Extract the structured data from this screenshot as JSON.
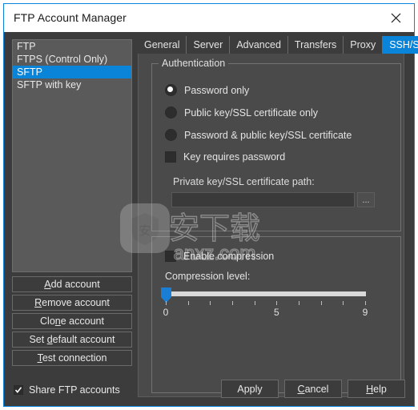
{
  "window": {
    "title": "FTP Account Manager",
    "close_icon": "close-icon",
    "accent_color": "#0a84d8",
    "background_color": "#3c3c3c",
    "titlebar_color": "#ffffff"
  },
  "accounts": {
    "items": [
      {
        "label": "FTP",
        "selected": false
      },
      {
        "label": "FTPS (Control Only)",
        "selected": false
      },
      {
        "label": "SFTP",
        "selected": true
      },
      {
        "label": "SFTP with key",
        "selected": false
      }
    ]
  },
  "left_buttons": [
    {
      "label": "Add account",
      "accel": "A"
    },
    {
      "label": "Remove account",
      "accel": "R"
    },
    {
      "label": "Clone account",
      "accel": "n"
    },
    {
      "label": "Set default account",
      "accel": "d"
    },
    {
      "label": "Test connection",
      "accel": "T"
    }
  ],
  "share": {
    "label": "Share FTP accounts",
    "checked": true
  },
  "tabs": {
    "items": [
      {
        "label": "General",
        "active": false
      },
      {
        "label": "Server",
        "active": false
      },
      {
        "label": "Advanced",
        "active": false
      },
      {
        "label": "Transfers",
        "active": false
      },
      {
        "label": "Proxy",
        "active": false
      },
      {
        "label": "SSH/SSL",
        "active": true
      }
    ],
    "scroll_left_icon": "triangle-left-icon",
    "scroll_right_icon": "triangle-right-icon"
  },
  "authentication": {
    "title": "Authentication",
    "options": [
      {
        "label": "Password only",
        "checked": true
      },
      {
        "label": "Public key/SSL certificate only",
        "checked": false
      },
      {
        "label": "Password & public key/SSL certificate",
        "checked": false
      }
    ],
    "key_requires_password": {
      "label": "Key requires password",
      "checked": false
    }
  },
  "private_key": {
    "label": "Private key/SSL certificate path:",
    "value": "",
    "placeholder": "",
    "browse_label": "..."
  },
  "compression": {
    "enable": {
      "label": "Enable compression",
      "checked": false
    },
    "level_label": "Compression level:",
    "value": 0,
    "min": 0,
    "max": 9,
    "tick_labels": [
      {
        "value": 0,
        "text": "0"
      },
      {
        "value": 5,
        "text": "5"
      },
      {
        "value": 9,
        "text": "9"
      }
    ]
  },
  "bottom_buttons": [
    {
      "id": "apply",
      "label": "Apply",
      "accel": ""
    },
    {
      "id": "cancel",
      "label": "Cancel",
      "accel": "C"
    },
    {
      "id": "help",
      "label": "Help",
      "accel": "H"
    }
  ],
  "watermark": {
    "text_cn": "安下载",
    "text_domain": "anxz.com",
    "shield_glyph": "安"
  }
}
